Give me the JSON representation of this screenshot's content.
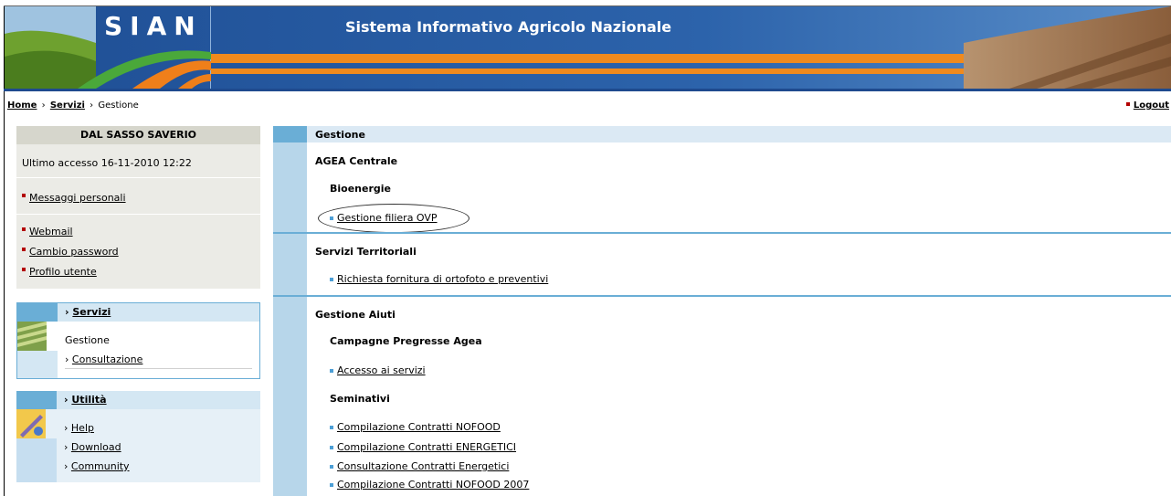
{
  "header": {
    "logo_text": "SIAN",
    "site_title": "Sistema Informativo Agricolo Nazionale"
  },
  "breadcrumb": {
    "home": "Home",
    "sep1": "›",
    "servizi": "Servizi",
    "sep2": "›",
    "current": "Gestione"
  },
  "logout_label": "Logout",
  "user_panel": {
    "name": "DAL SASSO SAVERIO",
    "last_access": "Ultimo accesso 16-11-2010 12:22",
    "messages": "Messaggi personali",
    "webmail": "Webmail",
    "change_password": "Cambio password",
    "profile": "Profilo utente"
  },
  "servizi_menu": {
    "title": "Servizi",
    "items": [
      "Gestione",
      "Consultazione"
    ]
  },
  "utilita_menu": {
    "title": "Utilità",
    "items": [
      "Help",
      "Download",
      "Community"
    ]
  },
  "main": {
    "gestione_title": "Gestione",
    "agea": {
      "title": "AGEA Centrale",
      "bioenergie": "Bioenergie",
      "filiera_link": "Gestione filiera OVP"
    },
    "servizi_territoriali": {
      "title": "Servizi Territoriali",
      "link": "Richiesta fornitura di ortofoto e preventivi"
    },
    "gestione_aiuti": {
      "title": "Gestione Aiuti",
      "campagne": "Campagne Pregresse Agea",
      "accesso": "Accesso ai servizi",
      "seminativi": "Seminativi",
      "links": [
        "Compilazione Contratti NOFOOD",
        "Compilazione Contratti ENERGETICI",
        "Consultazione Contratti Energetici",
        "Compilazione Contratti NOFOOD 2007"
      ]
    }
  },
  "colors": {
    "header_blue": "#1e4a8e",
    "accent_blue": "#6aaed6",
    "light_blue": "#b7d6ea",
    "bullet_red": "#b30000",
    "bullet_blue": "#4d9fd6"
  }
}
